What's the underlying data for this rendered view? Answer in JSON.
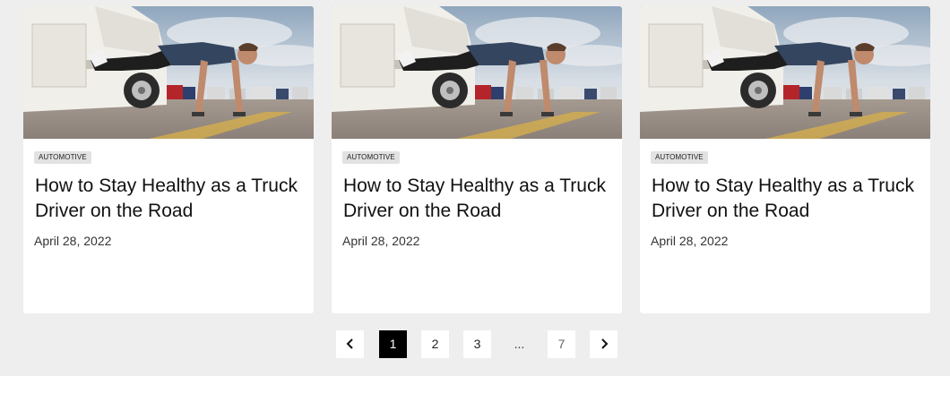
{
  "articles": [
    {
      "category": "AUTOMOTIVE",
      "title": "How to Stay Healthy as a Truck Driver on the Road",
      "date": "April 28, 2022",
      "image": "man-doing-pushup-on-truck-step-photo"
    },
    {
      "category": "AUTOMOTIVE",
      "title": "How to Stay Healthy as a Truck Driver on the Road",
      "date": "April 28, 2022",
      "image": "man-doing-pushup-on-truck-step-photo"
    },
    {
      "category": "AUTOMOTIVE",
      "title": "How to Stay Healthy as a Truck Driver on the Road",
      "date": "April 28, 2022",
      "image": "man-doing-pushup-on-truck-step-photo"
    }
  ],
  "pagination": {
    "prev_icon": "chevron-left-icon",
    "next_icon": "chevron-right-icon",
    "pages": [
      "1",
      "2",
      "3"
    ],
    "ellipsis": "...",
    "last_page": "7",
    "current": "1"
  },
  "colors": {
    "band_background": "#eeeeee",
    "card_background": "#ffffff",
    "badge_background": "#e2e2e2",
    "active_page": "#000000"
  }
}
